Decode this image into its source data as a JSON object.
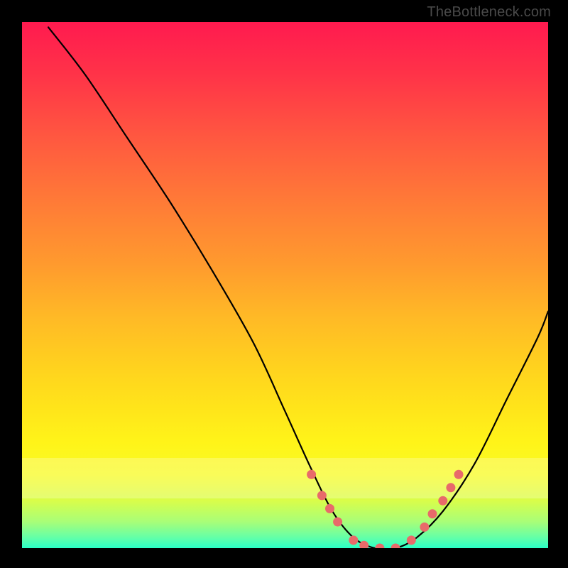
{
  "watermark": {
    "text": "TheBottleneck.com"
  },
  "chart_data": {
    "type": "line",
    "title": "",
    "xlabel": "",
    "ylabel": "",
    "xlim": [
      0,
      100
    ],
    "ylim": [
      0,
      100
    ],
    "series": [
      {
        "name": "bottleneck-curve",
        "x": [
          5,
          12,
          20,
          28,
          36,
          44,
          50,
          55,
          59,
          63,
          67,
          71,
          75,
          80,
          86,
          92,
          98,
          100
        ],
        "y": [
          99,
          90,
          78,
          66,
          53,
          39,
          26,
          15,
          7,
          2,
          0,
          0,
          2,
          7,
          16,
          28,
          40,
          45
        ]
      }
    ],
    "markers": {
      "name": "highlight-dots",
      "color": "#e86a6a",
      "x": [
        55,
        57,
        58.5,
        60,
        63,
        65,
        68,
        71,
        74,
        76.5,
        78,
        80,
        81.5,
        83
      ],
      "y": [
        14,
        10,
        7.5,
        5,
        1.5,
        0.5,
        0,
        0,
        1.5,
        4,
        6.5,
        9,
        11.5,
        14
      ]
    },
    "background_gradient": {
      "orientation": "vertical",
      "stops": [
        {
          "pos": 0.0,
          "color": "#ff1a4f"
        },
        {
          "pos": 0.22,
          "color": "#ff5840"
        },
        {
          "pos": 0.46,
          "color": "#ff9a2e"
        },
        {
          "pos": 0.66,
          "color": "#ffd31e"
        },
        {
          "pos": 0.86,
          "color": "#f8fb25"
        },
        {
          "pos": 1.0,
          "color": "#2affc6"
        }
      ]
    }
  }
}
